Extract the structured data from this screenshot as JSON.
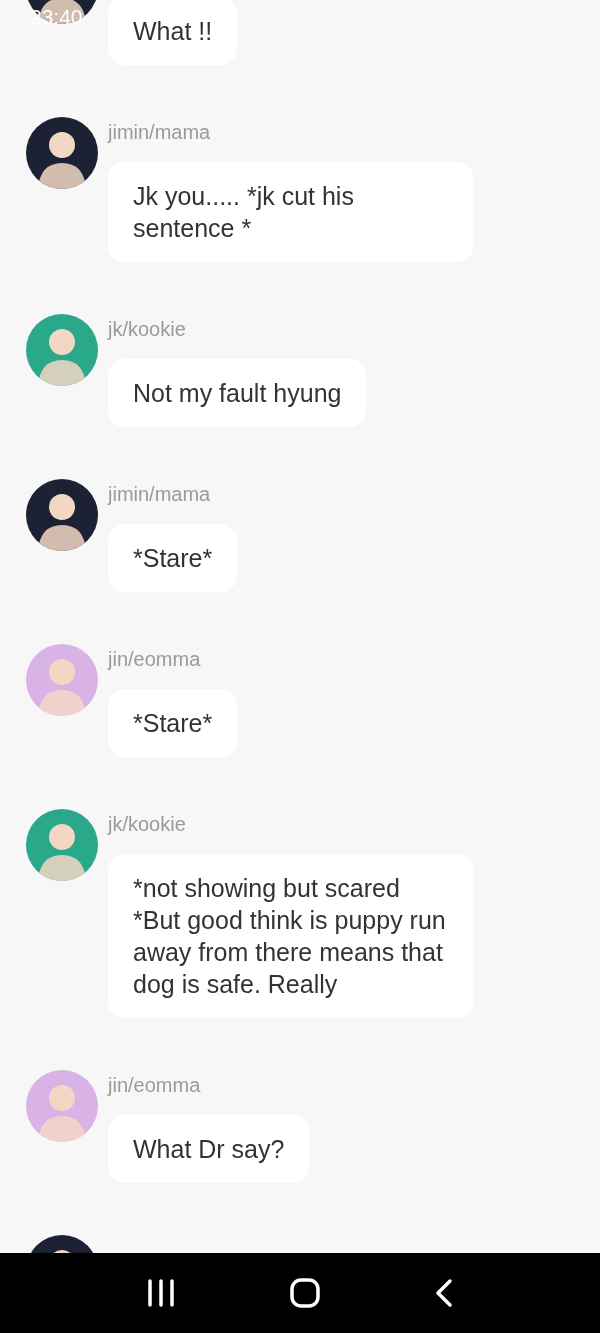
{
  "status_bar": {
    "time": "23:40"
  },
  "messages": [
    {
      "avatar": {
        "color": "#1c2233"
      },
      "text": "What !!"
    },
    {
      "name": "jimin/mama",
      "avatar": {
        "color": "#1c2233"
      },
      "text": "Jk you..... *jk cut his sentence *"
    },
    {
      "name": "jk/kookie",
      "avatar": {
        "color": "#2aa88a"
      },
      "text": "Not my fault hyung"
    },
    {
      "name": "jimin/mama",
      "avatar": {
        "color": "#1c2233"
      },
      "text": "*Stare*"
    },
    {
      "name": "jin/eomma",
      "avatar": {
        "color": "#d9b3e6"
      },
      "text": "*Stare*"
    },
    {
      "name": "jk/kookie",
      "avatar": {
        "color": "#2aa88a"
      },
      "text": "*not showing but scared *But good think is puppy run away from there means that dog is safe. Really"
    },
    {
      "name": "jin/eomma",
      "avatar": {
        "color": "#d9b3e6"
      },
      "text": "What Dr say?"
    },
    {
      "avatar": {
        "color": "#1c2233"
      }
    }
  ]
}
